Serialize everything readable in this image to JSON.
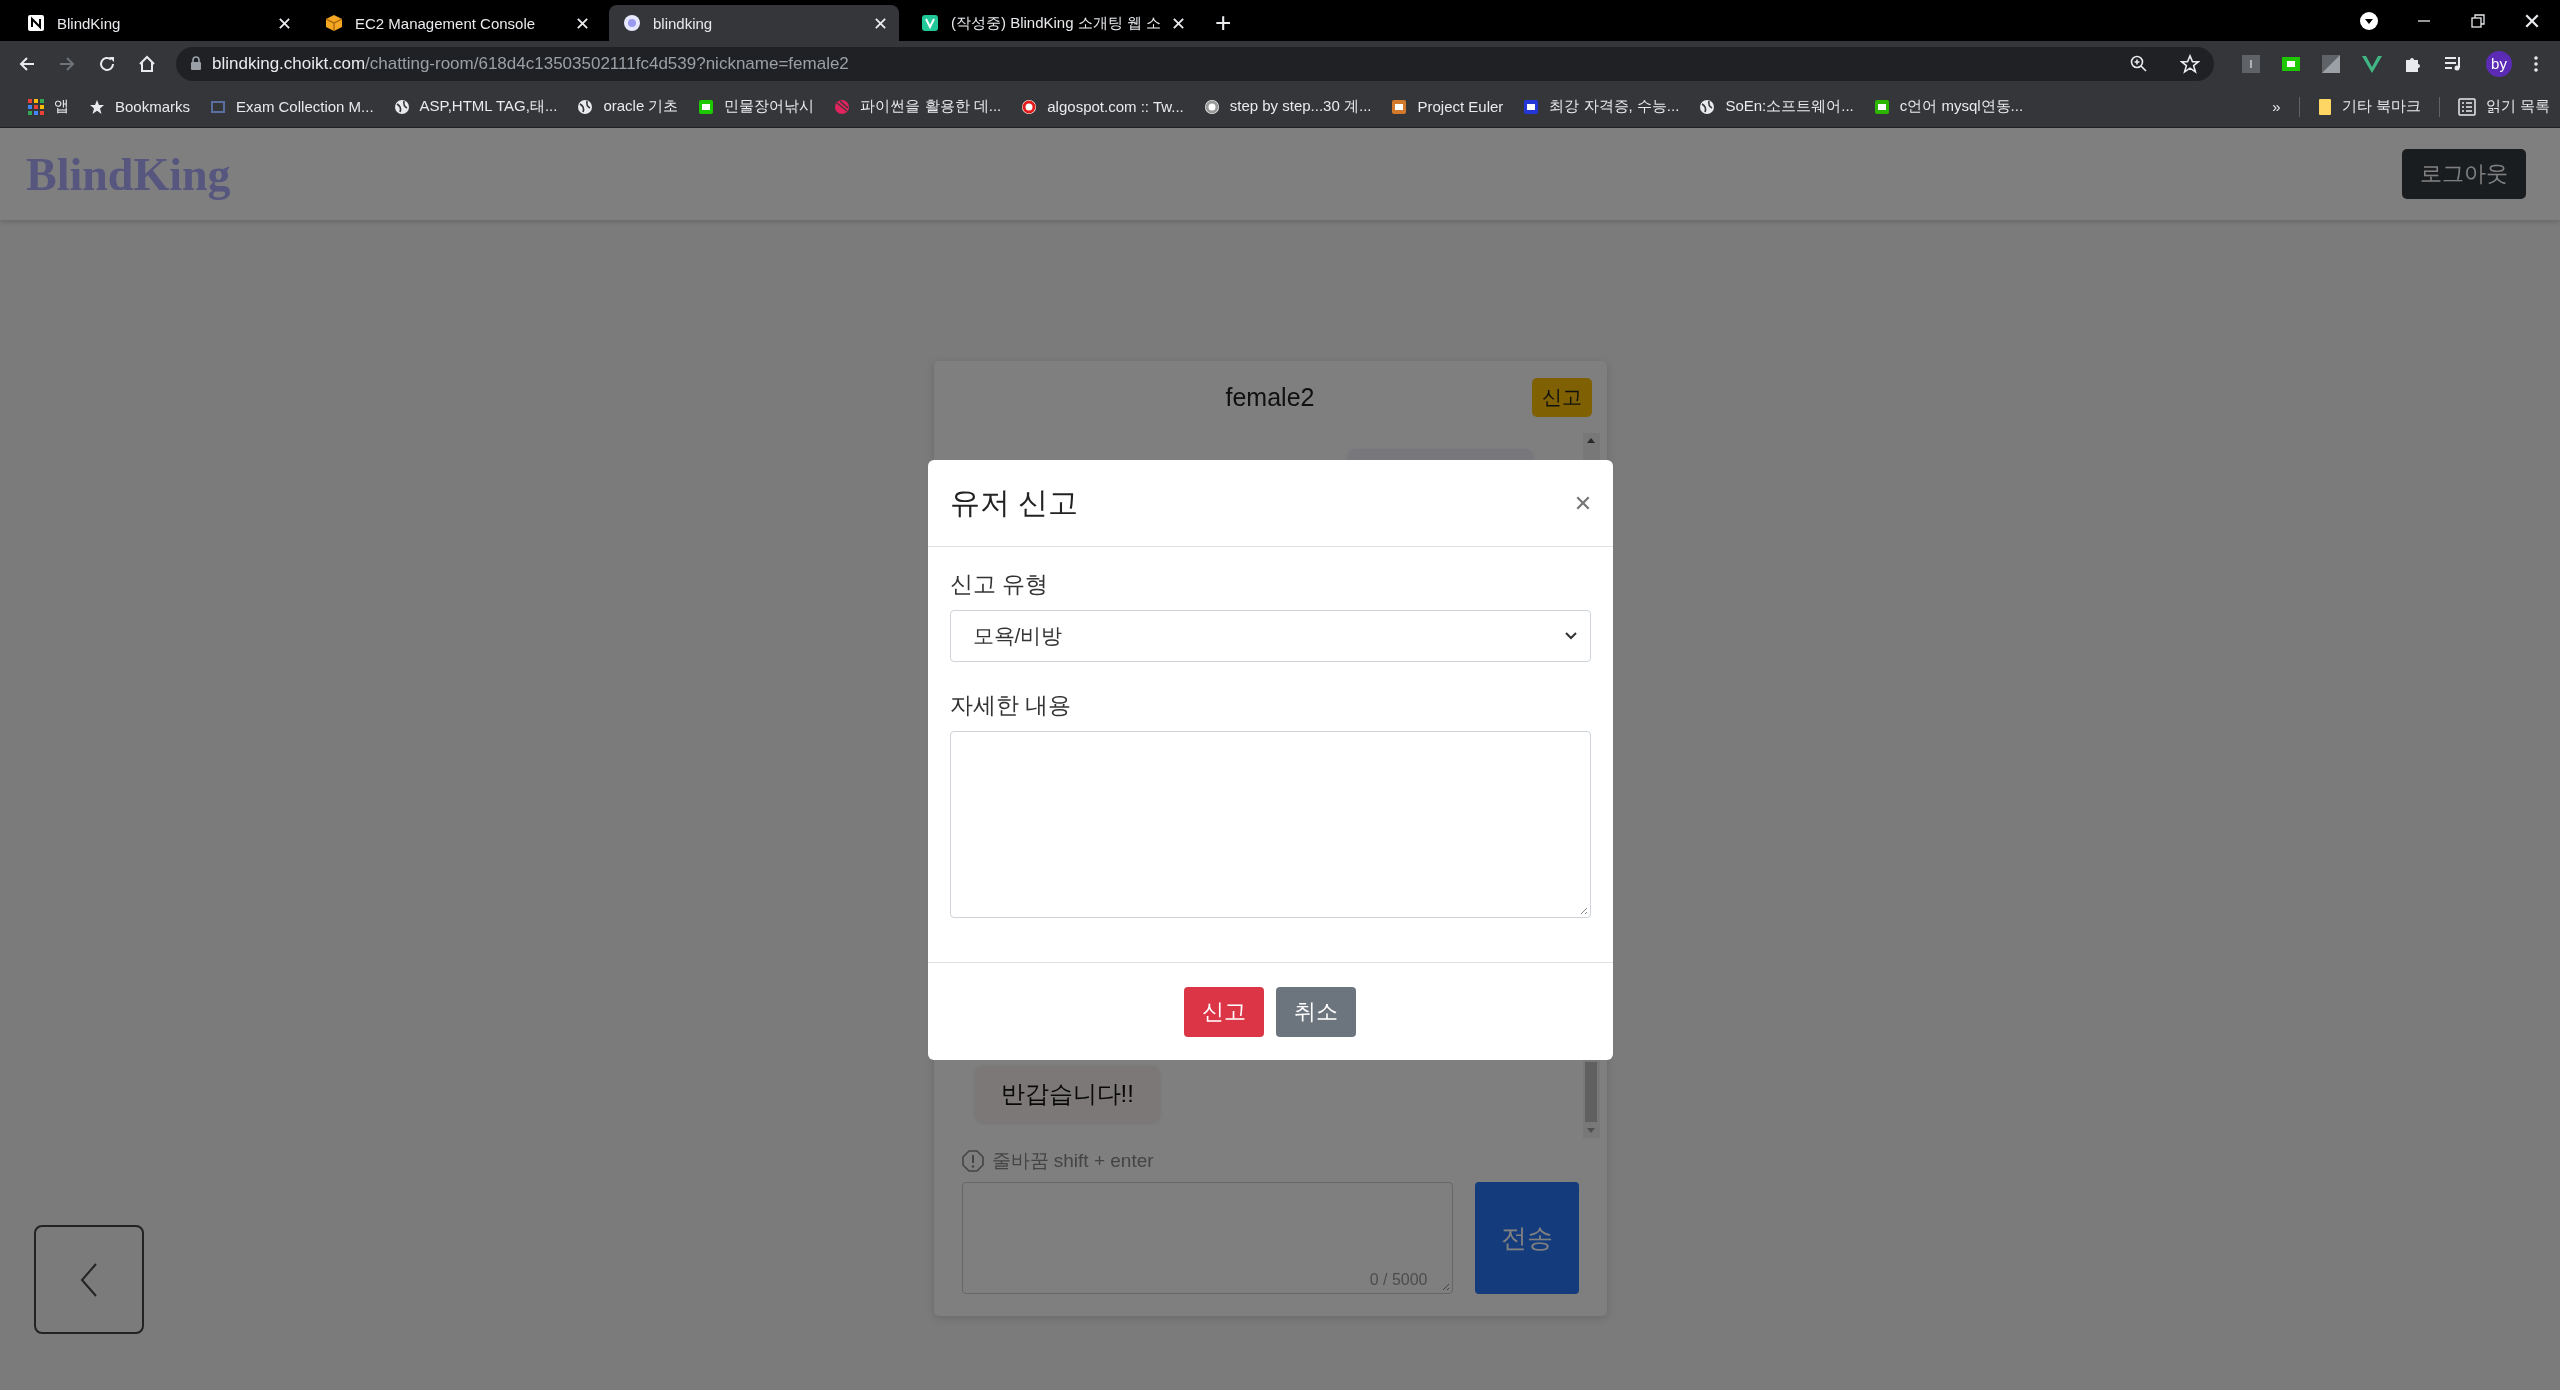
{
  "browser": {
    "tabs": [
      {
        "title": "BlindKing",
        "kind": "notion",
        "selected": false
      },
      {
        "title": "EC2 Management Console",
        "kind": "box",
        "selected": false
      },
      {
        "title": "blindking",
        "kind": "circle",
        "selected": true
      },
      {
        "title": "(작성중) BlindKing 소개팅 웹 소",
        "kind": "velog",
        "selected": false
      }
    ],
    "new_tab": "+",
    "address": {
      "host": "blindking.choikt.com",
      "path": "/chatting-room/618d4c13503502111fc4d539?nickname=female2"
    },
    "profile": "by",
    "bookmarks": [
      {
        "label": "앱",
        "kind": "apps"
      },
      {
        "label": "Bookmarks",
        "kind": "star"
      },
      {
        "label": "Exam Collection M...",
        "kind": "page",
        "color": "#5a6fa0"
      },
      {
        "label": "ASP,HTML TAG,태...",
        "kind": "globe"
      },
      {
        "label": "oracle 기초",
        "kind": "globe"
      },
      {
        "label": "민물장어낚시",
        "kind": "square",
        "color": "#1ec800"
      },
      {
        "label": "파이썬을 활용한 데...",
        "kind": "ball",
        "color": "#e0245e"
      },
      {
        "label": "algospot.com :: Tw...",
        "kind": "ring",
        "color": "#e31b1b"
      },
      {
        "label": "step by step...30 계...",
        "kind": "ring",
        "color": "#9a9a9a"
      },
      {
        "label": "Project Euler",
        "kind": "square",
        "color": "#d2792b"
      },
      {
        "label": "최강 자격증, 수능...",
        "kind": "square",
        "color": "#2336d6"
      },
      {
        "label": "SoEn:소프트웨어...",
        "kind": "globe"
      },
      {
        "label": "c언어 mysql연동...",
        "kind": "square",
        "color": "#2db400"
      }
    ],
    "overflow": "»",
    "other_bookmarks": "기타 북마크",
    "reading_list": "읽기 목록"
  },
  "navbar": {
    "logo": "BlindKing",
    "logout": "로그아웃"
  },
  "chat": {
    "partner": "female2",
    "report_button": "신고",
    "messages": [
      {
        "kind": "sent"
      },
      {
        "kind": "received",
        "text": "반갑습니다!!"
      }
    ],
    "hint": "줄바꿈 shift + enter",
    "counter": "0 / 5000",
    "send": "전송"
  },
  "modal": {
    "title": "유저 신고",
    "type_label": "신고 유형",
    "type_value": "모욕/비방",
    "detail_label": "자세한 내용",
    "buttons": [
      {
        "label": "신고",
        "kind": "danger"
      },
      {
        "label": "취소",
        "kind": "secondary"
      }
    ]
  }
}
